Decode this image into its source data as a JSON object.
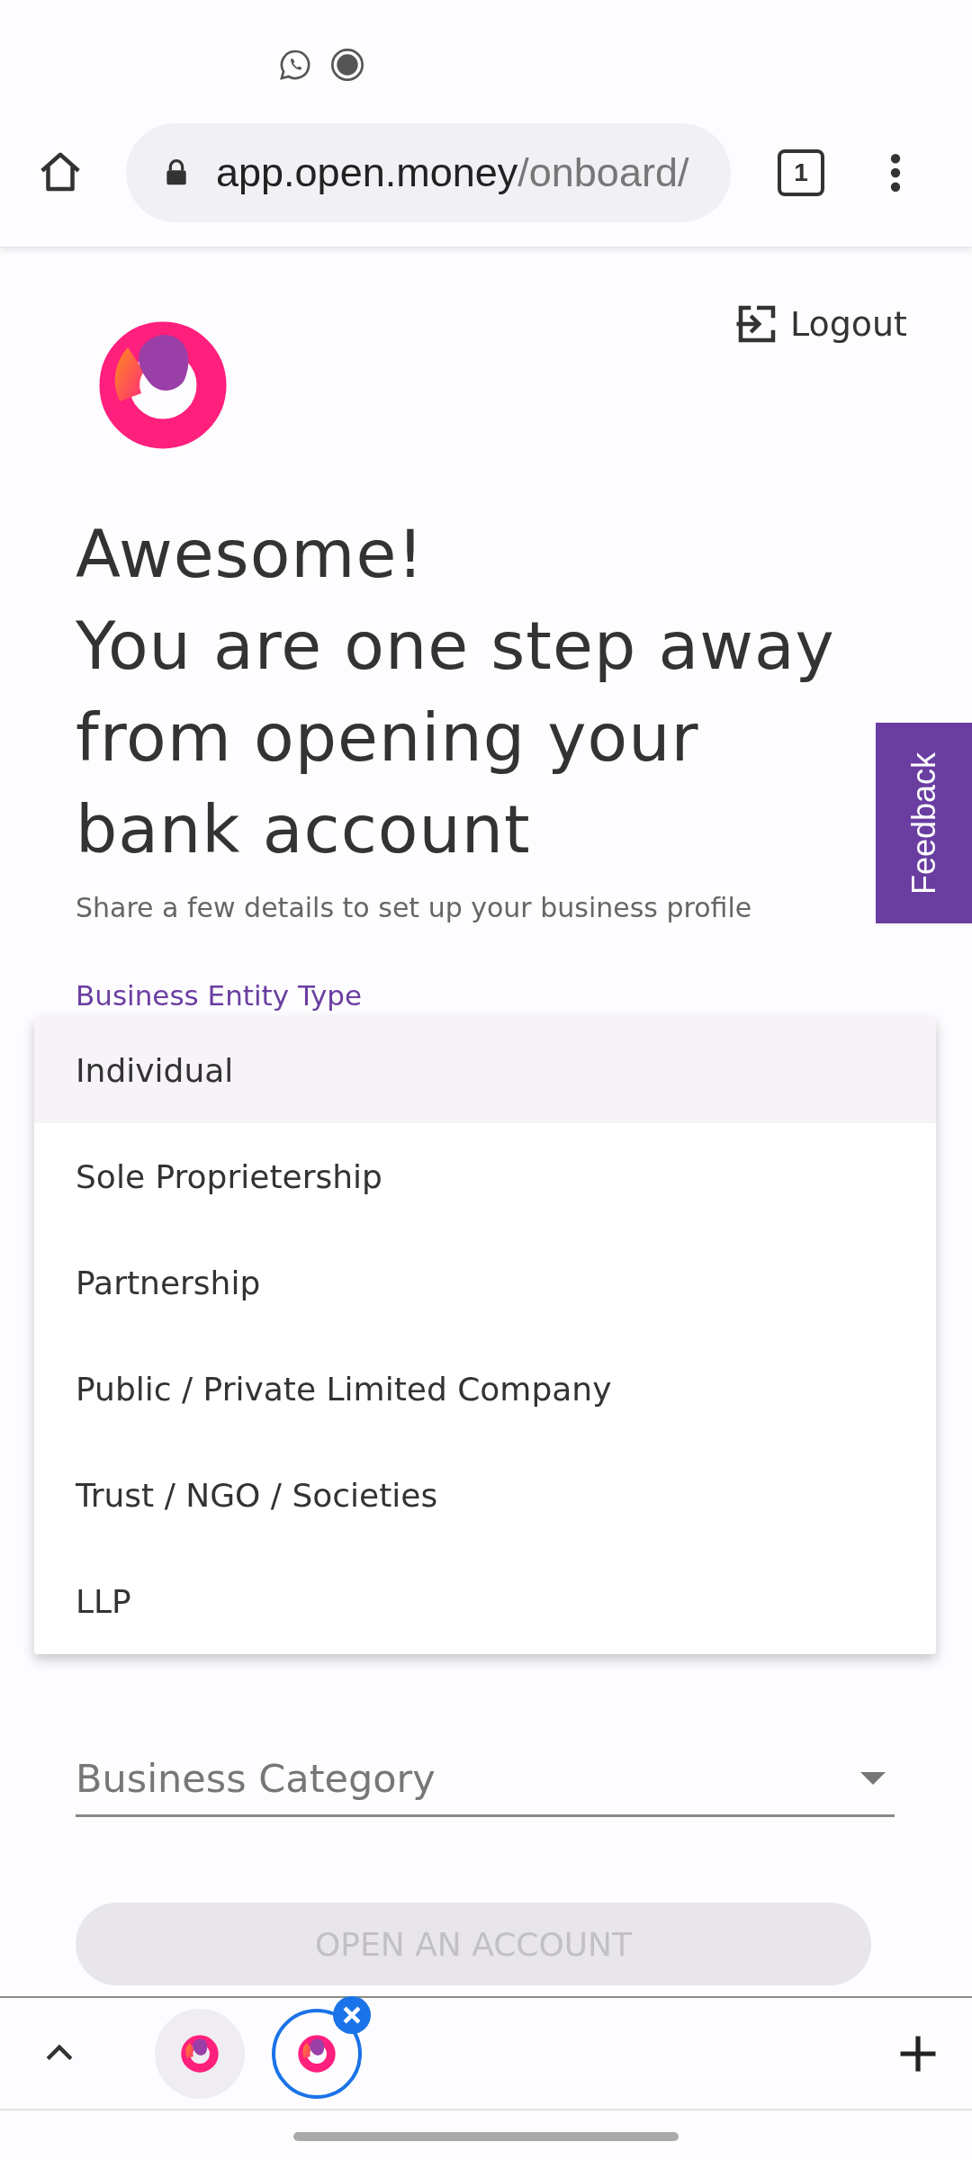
{
  "browser": {
    "url_host": "app.open.money",
    "url_path": "/onboard/",
    "tab_count": "1"
  },
  "page": {
    "logout": "Logout",
    "heading": [
      "Awesome!",
      "You are one step away",
      "from opening your",
      "bank account"
    ],
    "subtitle": "Share a few details to set up your business profile",
    "feedback": "Feedback",
    "entity_field": {
      "label": "Business Entity Type"
    },
    "dropdown": [
      {
        "label": "Individual",
        "selected": true
      },
      {
        "label": "Sole Proprietership",
        "selected": false
      },
      {
        "label": "Partnership",
        "selected": false
      },
      {
        "label": "Public / Private Limited Company",
        "selected": false
      },
      {
        "label": "Trust / NGO / Societies",
        "selected": false
      },
      {
        "label": "LLP",
        "selected": false
      }
    ],
    "category_field": {
      "placeholder": "Business Category"
    },
    "submit": {
      "label": "OPEN AN ACCOUNT",
      "disabled": true
    }
  },
  "tab_strip": {
    "tabs": [
      {
        "selected": false
      },
      {
        "selected": true
      }
    ]
  }
}
